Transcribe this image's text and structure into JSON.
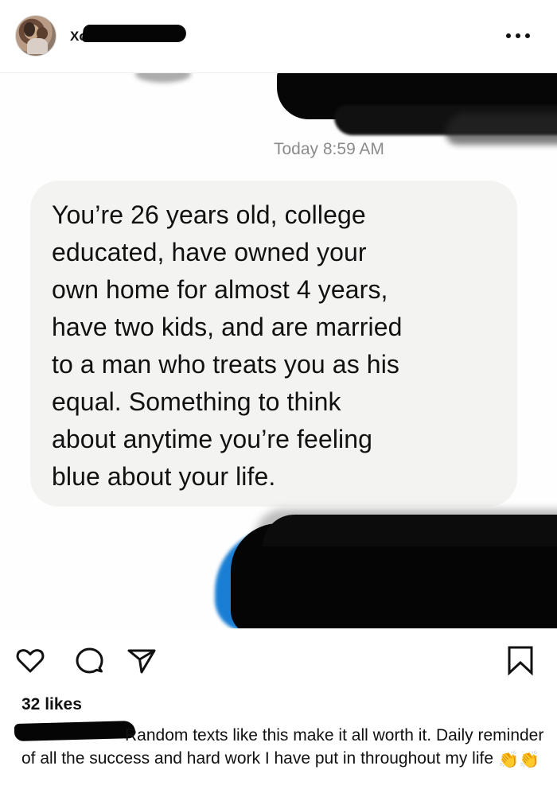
{
  "header": {
    "username_visible": "Xo",
    "more_icon": "more-horizontal-icon"
  },
  "post": {
    "timestamp": "Today 8:59 AM",
    "message": "You’re 26 years old, college\neducated, have owned your\nown home for almost 4 years,\nhave two kids, and are married\nto a man who treats you as his\nequal. Something to think\nabout anytime you’re feeling\nblue about your life."
  },
  "actions": {
    "like_icon": "heart-icon",
    "comment_icon": "comment-bubble-icon",
    "share_icon": "paper-plane-icon",
    "save_icon": "bookmark-icon"
  },
  "likes": "32 likes",
  "caption": {
    "text": "Random texts like this make it all worth it. Daily reminder of all the success and hard work I have put in throughout my life",
    "emoji": "👏👏"
  },
  "colors": {
    "text": "#111111",
    "timestamp": "#8b8b8b",
    "bubble": "#f3f3f2",
    "redaction_blue": "#1a7fd4"
  }
}
